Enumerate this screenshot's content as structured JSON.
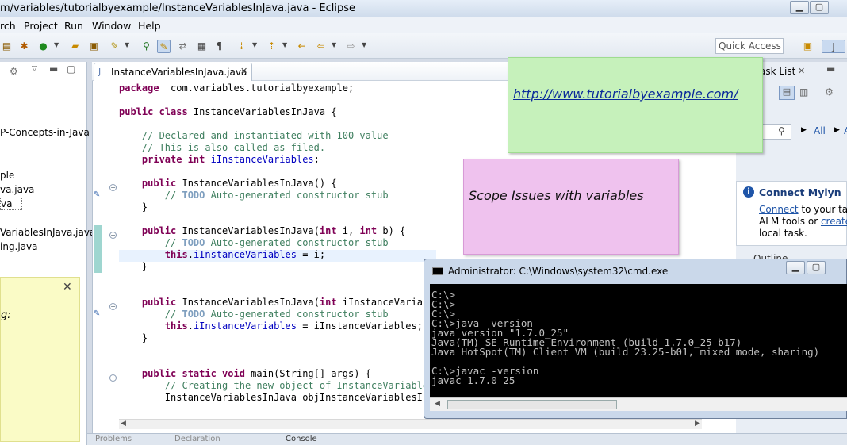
{
  "window": {
    "title": "m/variables/tutorialbyexample/InstanceVariablesInJava.java - Eclipse",
    "minimize": "▁",
    "maximize": "▢"
  },
  "menu": [
    "rch",
    "Project",
    "Run",
    "Window",
    "Help"
  ],
  "quick_access": "Quick Access",
  "left_panel": {
    "items": [
      "P-Concepts-in-Java",
      "ple",
      "va.java",
      "va",
      "VariablesInJava.java",
      "ing.java"
    ],
    "sticky_text": "g:"
  },
  "editor": {
    "tab_label": "InstanceVariablesInJava.java",
    "lines": [
      {
        "n": 1,
        "segs": [
          [
            "kw",
            "package"
          ],
          [
            "",
            "  com.variables.tutorialbyexample;"
          ]
        ]
      },
      {
        "n": 2,
        "segs": []
      },
      {
        "n": 3,
        "segs": [
          [
            "kw",
            "public class"
          ],
          [
            "",
            " InstanceVariablesInJava {"
          ]
        ]
      },
      {
        "n": 4,
        "segs": []
      },
      {
        "n": 5,
        "segs": [
          [
            "cm",
            "    // Declared and instantiated with 100 value"
          ]
        ]
      },
      {
        "n": 6,
        "segs": [
          [
            "cm",
            "    // This is also called as filed."
          ]
        ]
      },
      {
        "n": 7,
        "segs": [
          [
            "kw",
            "    private int"
          ],
          [
            "fd",
            " iInstanceVariables"
          ],
          [
            "",
            ";"
          ]
        ]
      },
      {
        "n": 8,
        "segs": []
      },
      {
        "n": 9,
        "segs": [
          [
            "kw",
            "    public"
          ],
          [
            "",
            " InstanceVariablesInJava() {"
          ]
        ]
      },
      {
        "n": 10,
        "segs": [
          [
            "cm",
            "        // "
          ],
          [
            "td",
            "TODO"
          ],
          [
            "cm",
            " Auto-generated constructor stub"
          ]
        ]
      },
      {
        "n": 11,
        "segs": [
          [
            "",
            "    }"
          ]
        ]
      },
      {
        "n": 12,
        "segs": []
      },
      {
        "n": 13,
        "segs": [
          [
            "kw",
            "    public"
          ],
          [
            "",
            " InstanceVariablesInJava("
          ],
          [
            "kw",
            "int"
          ],
          [
            "",
            " i, "
          ],
          [
            "kw",
            "int"
          ],
          [
            "",
            " b) {"
          ]
        ]
      },
      {
        "n": 14,
        "segs": [
          [
            "cm",
            "        // "
          ],
          [
            "td",
            "TODO"
          ],
          [
            "cm",
            " Auto-generated constructor stub"
          ]
        ]
      },
      {
        "n": 15,
        "segs": [
          [
            "kw",
            "        this"
          ],
          [
            "",
            "."
          ],
          [
            "fd",
            "iInstanceVariables"
          ],
          [
            "",
            " = i;"
          ]
        ]
      },
      {
        "n": 16,
        "segs": [
          [
            "",
            "    }"
          ]
        ]
      },
      {
        "n": 17,
        "segs": []
      },
      {
        "n": 18,
        "segs": []
      },
      {
        "n": 19,
        "segs": [
          [
            "kw",
            "    public"
          ],
          [
            "",
            " InstanceVariablesInJava("
          ],
          [
            "kw",
            "int"
          ],
          [
            "",
            " iInstanceVariabl"
          ]
        ]
      },
      {
        "n": 20,
        "segs": [
          [
            "cm",
            "        // "
          ],
          [
            "td",
            "TODO"
          ],
          [
            "cm",
            " Auto-generated constructor stub"
          ]
        ]
      },
      {
        "n": 21,
        "segs": [
          [
            "kw",
            "        this"
          ],
          [
            "",
            "."
          ],
          [
            "fd",
            "iInstanceVariables"
          ],
          [
            "",
            " = iInstanceVariables;"
          ]
        ]
      },
      {
        "n": 22,
        "segs": [
          [
            "",
            "    }"
          ]
        ]
      },
      {
        "n": 23,
        "segs": []
      },
      {
        "n": 24,
        "segs": []
      },
      {
        "n": 25,
        "segs": [
          [
            "kw",
            "    public static void"
          ],
          [
            "",
            " main(String[] args) {"
          ]
        ]
      },
      {
        "n": 26,
        "segs": [
          [
            "cm",
            "        // Creating the new object of InstanceVariables"
          ]
        ]
      },
      {
        "n": 27,
        "segs": [
          [
            "",
            "        InstanceVariablesInJava objInstanceVariablesInJ"
          ]
        ]
      }
    ]
  },
  "right_panel": {
    "task_list": "ask List",
    "find_placeholder": "d",
    "all_label": "All",
    "a_label": "A",
    "connect_mylyn_title": "Connect Mylyn",
    "connect_text_1": "Connect",
    "connect_text_2": " to your task",
    "connect_text_3": "ALM tools or ",
    "connect_text_4": "create",
    "connect_text_5": " a",
    "connect_text_6": "local task.",
    "outline": "Outline"
  },
  "green_sticky": {
    "link": "http://www.tutorialbyexample.com/"
  },
  "pink_sticky": {
    "text": "Scope Issues with variables"
  },
  "cmd": {
    "title": "Administrator: C:\\Windows\\system32\\cmd.exe",
    "output": "C:\\>\nC:\\>\nC:\\>\nC:\\>java -version\njava version \"1.7.0_25\"\nJava(TM) SE Runtime Environment (build 1.7.0_25-b17)\nJava HotSpot(TM) Client VM (build 23.25-b01, mixed mode, sharing)\n\nC:\\>javac -version\njavac 1.7.0_25"
  },
  "bottom": {
    "tabs": [
      "Problems",
      "Declaration",
      "Console"
    ]
  }
}
